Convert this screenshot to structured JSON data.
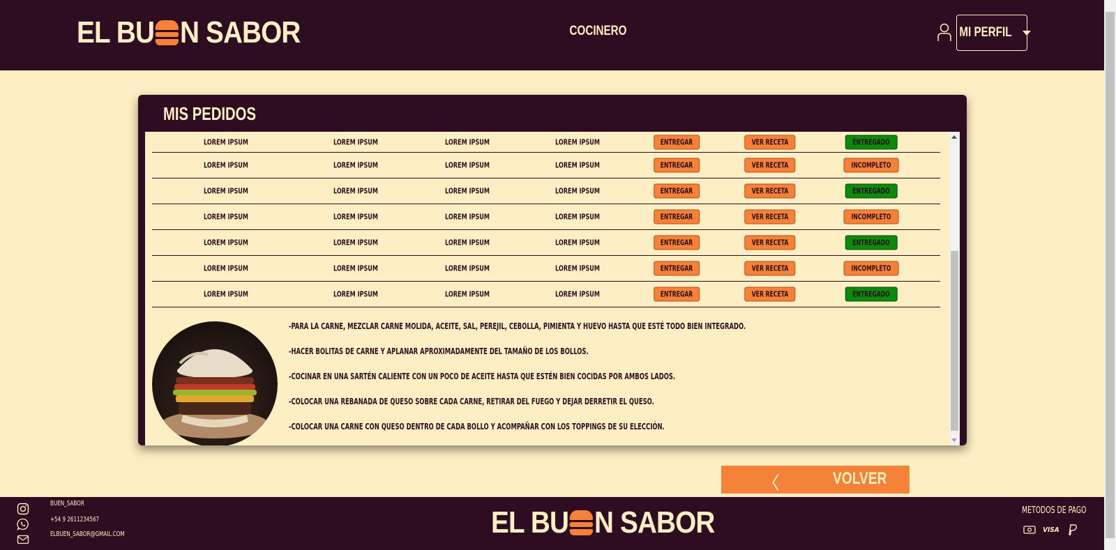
{
  "header": {
    "logo_left": "EL BU",
    "logo_right": "N SABOR",
    "role": "COCINERO",
    "profile_label": "MI PERFIL"
  },
  "panel": {
    "title": "MIS PEDIDOS",
    "orders": [
      {
        "c1": "LOREM IPSUM",
        "c2": "LOREM IPSUM",
        "c3": "LOREM IPSUM",
        "c4": "LOREM IPSUM",
        "deliver": "ENTREGAR",
        "recipe": "VER RECETA",
        "status": "ENTREGADO",
        "status_color": "#0b8a0b"
      },
      {
        "c1": "LOREM IPSUM",
        "c2": "LOREM IPSUM",
        "c3": "LOREM IPSUM",
        "c4": "LOREM IPSUM",
        "deliver": "ENTREGAR",
        "recipe": "VER RECETA",
        "status": "INCOMPLETO",
        "status_color": "#f58238"
      },
      {
        "c1": "LOREM IPSUM",
        "c2": "LOREM IPSUM",
        "c3": "LOREM IPSUM",
        "c4": "LOREM IPSUM",
        "deliver": "ENTREGAR",
        "recipe": "VER RECETA",
        "status": "ENTREGADO",
        "status_color": "#0b8a0b"
      },
      {
        "c1": "LOREM IPSUM",
        "c2": "LOREM IPSUM",
        "c3": "LOREM IPSUM",
        "c4": "LOREM IPSUM",
        "deliver": "ENTREGAR",
        "recipe": "VER RECETA",
        "status": "INCOMPLETO",
        "status_color": "#f58238"
      },
      {
        "c1": "LOREM IPSUM",
        "c2": "LOREM IPSUM",
        "c3": "LOREM IPSUM",
        "c4": "LOREM IPSUM",
        "deliver": "ENTREGAR",
        "recipe": "VER RECETA",
        "status": "ENTREGADO",
        "status_color": "#0b8a0b"
      },
      {
        "c1": "LOREM IPSUM",
        "c2": "LOREM IPSUM",
        "c3": "LOREM IPSUM",
        "c4": "LOREM IPSUM",
        "deliver": "ENTREGAR",
        "recipe": "VER RECETA",
        "status": "INCOMPLETO",
        "status_color": "#f58238"
      },
      {
        "c1": "LOREM IPSUM",
        "c2": "LOREM IPSUM",
        "c3": "LOREM IPSUM",
        "c4": "LOREM IPSUM",
        "deliver": "ENTREGAR",
        "recipe": "VER RECETA",
        "status": "ENTREGADO",
        "status_color": "#0b8a0b"
      }
    ],
    "recipe_steps": [
      "-PARA LA CARNE, MEZCLAR CARNE MOLIDA, ACEITE, SAL, PEREJIL, CEBOLLA, PIMIENTA Y HUEVO HASTA QUE ESTÉ TODO BIEN INTEGRADO.",
      "-HACER BOLITAS DE CARNE Y APLANAR APROXIMADAMENTE DEL TAMAÑO DE LOS BOLLOS.",
      "-COCINAR EN UNA SARTÉN CALIENTE CON UN POCO DE ACEITE HASTA QUE ESTÉN BIEN COCIDAS POR AMBOS LADOS.",
      "-COLOCAR UNA REBANADA DE QUESO SOBRE CADA CARNE, RETIRAR DEL FUEGO Y DEJAR DERRETIR EL QUESO.",
      "-COLOCAR UNA CARNE CON QUESO DENTRO DE CADA BOLLO Y ACOMPAÑAR CON LOS TOPPINGS DE SU ELECCIÓN."
    ]
  },
  "back_button": {
    "chevron": "〈",
    "label": "VOLVER"
  },
  "footer": {
    "instagram": "BUEN_SABOR",
    "phone": "+54 9 2611234567",
    "email": "ELBUEN_SABOR@GMAIL.COM",
    "logo_left": "EL BU",
    "logo_right": "N SABOR",
    "payment_title": "METODOS DE PAGO",
    "visa_label": "VISA"
  },
  "colors": {
    "dark": "#2e0d22",
    "cream": "#fdefc3",
    "accent": "#f58238",
    "green": "#0b8a0b"
  }
}
